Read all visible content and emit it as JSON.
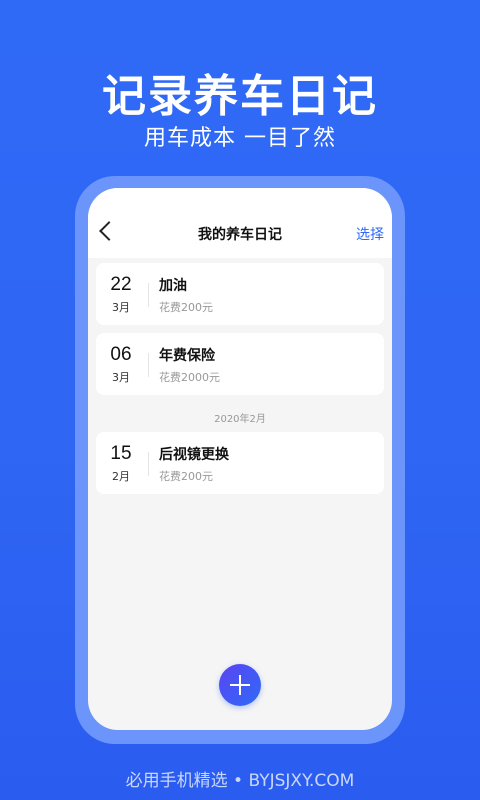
{
  "promo": {
    "headline": "记录养车日记",
    "subline": "用车成本  一目了然",
    "watermark": "必用手机精选 • BYJSJXY.COM"
  },
  "nav": {
    "title": "我的养车日记",
    "action": "选择"
  },
  "entries": [
    {
      "day": "22",
      "month": "3月",
      "title": "加油",
      "cost": "花费200元"
    },
    {
      "day": "06",
      "month": "3月",
      "title": "年费保险",
      "cost": "花费2000元"
    }
  ],
  "section": {
    "label": "2020年2月"
  },
  "entries_feb": [
    {
      "day": "15",
      "month": "2月",
      "title": "后视镜更换",
      "cost": "花费200元"
    }
  ],
  "colors": {
    "background": "#2f6af7",
    "accent": "#2f6af7",
    "fab_gradient_start": "#5b44f2"
  },
  "icons": {
    "back": "chevron-left-icon",
    "add": "plus-icon"
  }
}
